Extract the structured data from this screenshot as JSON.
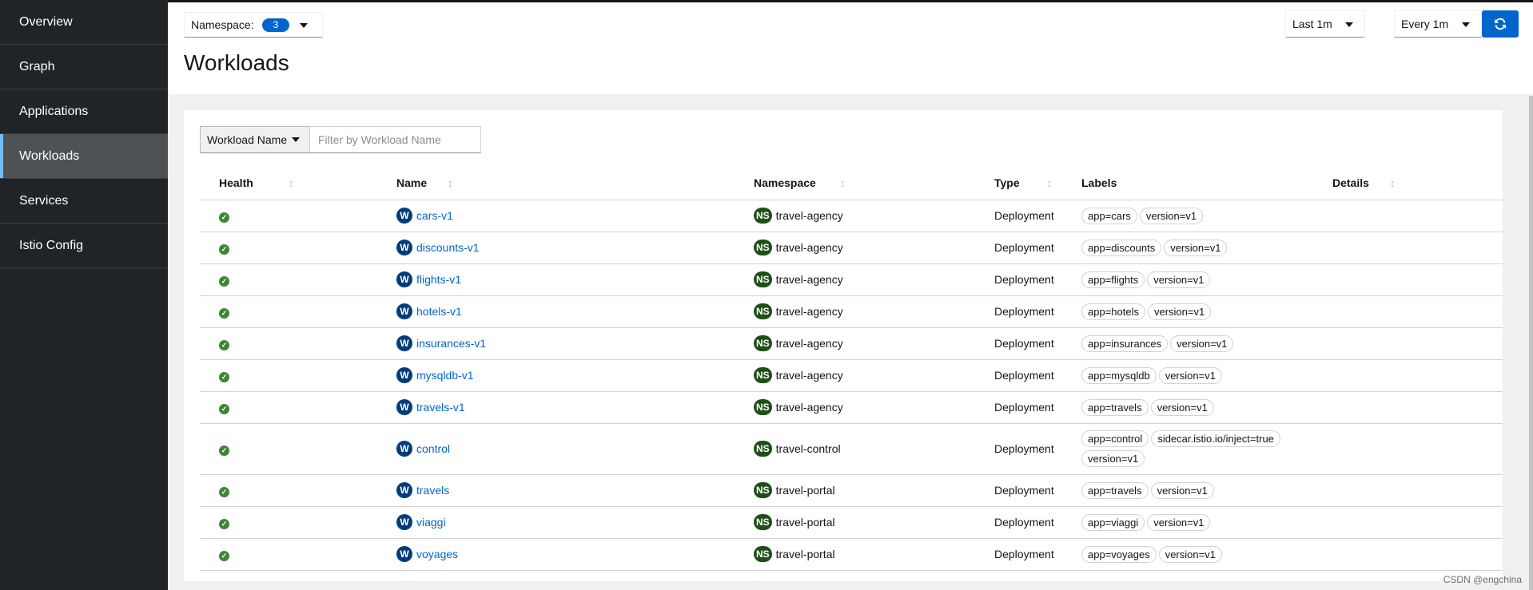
{
  "sidebar": {
    "items": [
      {
        "label": "Overview",
        "active": false
      },
      {
        "label": "Graph",
        "active": false
      },
      {
        "label": "Applications",
        "active": false
      },
      {
        "label": "Workloads",
        "active": true
      },
      {
        "label": "Services",
        "active": false
      },
      {
        "label": "Istio Config",
        "active": false
      }
    ]
  },
  "header": {
    "namespace_label": "Namespace:",
    "namespace_count": "3",
    "title": "Workloads",
    "duration": "Last 1m",
    "refresh_interval": "Every 1m",
    "refresh_icon": "sync-icon"
  },
  "filter": {
    "type": "Workload Name",
    "placeholder": "Filter by Workload Name"
  },
  "table": {
    "headers": {
      "health": "Health",
      "name": "Name",
      "namespace": "Namespace",
      "type": "Type",
      "labels": "Labels",
      "details": "Details"
    },
    "workload_badge": "W",
    "namespace_badge": "NS",
    "rows": [
      {
        "name": "cars-v1",
        "namespace": "travel-agency",
        "type": "Deployment",
        "labels": [
          "app=cars",
          "version=v1"
        ]
      },
      {
        "name": "discounts-v1",
        "namespace": "travel-agency",
        "type": "Deployment",
        "labels": [
          "app=discounts",
          "version=v1"
        ]
      },
      {
        "name": "flights-v1",
        "namespace": "travel-agency",
        "type": "Deployment",
        "labels": [
          "app=flights",
          "version=v1"
        ]
      },
      {
        "name": "hotels-v1",
        "namespace": "travel-agency",
        "type": "Deployment",
        "labels": [
          "app=hotels",
          "version=v1"
        ]
      },
      {
        "name": "insurances-v1",
        "namespace": "travel-agency",
        "type": "Deployment",
        "labels": [
          "app=insurances",
          "version=v1"
        ]
      },
      {
        "name": "mysqldb-v1",
        "namespace": "travel-agency",
        "type": "Deployment",
        "labels": [
          "app=mysqldb",
          "version=v1"
        ]
      },
      {
        "name": "travels-v1",
        "namespace": "travel-agency",
        "type": "Deployment",
        "labels": [
          "app=travels",
          "version=v1"
        ]
      },
      {
        "name": "control",
        "namespace": "travel-control",
        "type": "Deployment",
        "labels": [
          "app=control",
          "sidecar.istio.io/inject=true",
          "version=v1"
        ]
      },
      {
        "name": "travels",
        "namespace": "travel-portal",
        "type": "Deployment",
        "labels": [
          "app=travels",
          "version=v1"
        ]
      },
      {
        "name": "viaggi",
        "namespace": "travel-portal",
        "type": "Deployment",
        "labels": [
          "app=viaggi",
          "version=v1"
        ]
      },
      {
        "name": "voyages",
        "namespace": "travel-portal",
        "type": "Deployment",
        "labels": [
          "app=voyages",
          "version=v1"
        ]
      }
    ]
  },
  "colors": {
    "sidebar_bg": "#212427",
    "active_accent": "#73bcf7",
    "primary": "#0066cc",
    "health_ok": "#3e8635",
    "workload_badge": "#003d7a",
    "namespace_badge": "#1e4f18"
  },
  "watermark": "CSDN @engchina"
}
